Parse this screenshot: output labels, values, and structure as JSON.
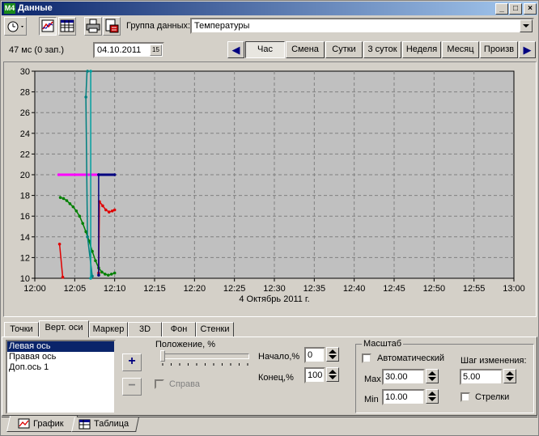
{
  "window": {
    "title": "Данные",
    "app_icon_text": "M4",
    "controls": [
      "_",
      "□",
      "×"
    ]
  },
  "toolbar": {
    "group_label": "Группа данных:",
    "group_value": "Температуры",
    "icons": [
      "clock-icon",
      "chart-view-icon",
      "table-view-icon",
      "print-icon",
      "export-icon"
    ]
  },
  "status": {
    "timing": "47 мс (0 зап.)",
    "date": "04.10.2011",
    "calendar_icon_text": "15"
  },
  "periods": {
    "prev_arrow": "◀",
    "next_arrow": "▶",
    "items": [
      "Час",
      "Смена",
      "Сутки",
      "3 суток",
      "Неделя",
      "Месяц",
      "Произв"
    ],
    "active_index": 0
  },
  "chart_data": {
    "type": "line",
    "ylim": [
      10,
      30
    ],
    "yticks": [
      "10",
      "12",
      "14",
      "16",
      "18",
      "20",
      "22",
      "24",
      "26",
      "28",
      "30"
    ],
    "xlim_minutes": [
      0,
      60
    ],
    "xticks": [
      "12:00",
      "12:05",
      "12:10",
      "12:15",
      "12:20",
      "12:25",
      "12:30",
      "12:35",
      "12:40",
      "12:45",
      "12:50",
      "12:55",
      "13:00"
    ],
    "xlabel": "4 Октябрь 2011 г.",
    "grid": true,
    "series": [
      {
        "color": "#008000",
        "points": [
          [
            3.2,
            17.8
          ],
          [
            3.6,
            17.7
          ],
          [
            4.0,
            17.5
          ],
          [
            4.4,
            17.2
          ],
          [
            4.8,
            16.9
          ],
          [
            5.2,
            16.5
          ],
          [
            5.6,
            16.0
          ],
          [
            6.0,
            15.3
          ],
          [
            6.4,
            14.5
          ],
          [
            6.8,
            13.6
          ],
          [
            7.2,
            12.6
          ],
          [
            7.6,
            11.7
          ],
          [
            8.0,
            11.0
          ],
          [
            8.4,
            10.6
          ],
          [
            8.8,
            10.4
          ],
          [
            9.2,
            10.3
          ],
          [
            9.6,
            10.4
          ],
          [
            10.0,
            10.5
          ]
        ]
      },
      {
        "color": "#e00000",
        "points": [
          [
            3.1,
            13.3
          ],
          [
            3.5,
            10.1
          ]
        ]
      },
      {
        "color": "#e00000",
        "points": [
          [
            8.0,
            10.5
          ],
          [
            8.1,
            17.4
          ],
          [
            8.5,
            17.0
          ],
          [
            8.9,
            16.6
          ],
          [
            9.3,
            16.4
          ],
          [
            9.7,
            16.5
          ],
          [
            10.0,
            16.6
          ]
        ]
      },
      {
        "color": "#ff00ff",
        "points": [
          [
            3.0,
            20.0
          ],
          [
            8.0,
            20.0
          ]
        ]
      },
      {
        "color": "#000080",
        "points": [
          [
            8.0,
            20.0
          ],
          [
            10.0,
            20.0
          ]
        ]
      },
      {
        "color": "#000080",
        "points": [
          [
            8.0,
            10.3
          ],
          [
            8.0,
            20.0
          ]
        ]
      },
      {
        "color": "#008080",
        "points": [
          [
            6.6,
            31.0
          ],
          [
            6.4,
            27.5
          ],
          [
            6.6,
            14.0
          ],
          [
            7.2,
            10.2
          ]
        ]
      },
      {
        "color": "#00a0a0",
        "points": [
          [
            7.0,
            31.0
          ],
          [
            7.0,
            10.0
          ]
        ]
      }
    ]
  },
  "tabs": {
    "items": [
      "Точки",
      "Верт. оси",
      "Маркер",
      "3D",
      "Фон",
      "Стенки"
    ],
    "active_index": 1
  },
  "axes_panel": {
    "axis_list": [
      "Левая ось",
      "Правая ось",
      "Доп.ось 1"
    ],
    "selected_index": 0,
    "add_label": "+",
    "remove_label": "−",
    "position_label": "Положение, %",
    "position_value": 0,
    "right_side_label": "Справа",
    "start_label": "Начало,%",
    "start_value": "0",
    "end_label": "Конец,%",
    "end_value": "100"
  },
  "scale": {
    "group_label": "Масштаб",
    "auto_label": "Автоматический",
    "auto_checked": false,
    "step_label": "Шаг изменения:",
    "step_value": "5.00",
    "max_label": "Max",
    "max_value": "30.00",
    "min_label": "Min",
    "min_value": "10.00",
    "arrows_label": "Стрелки",
    "arrows_checked": false
  },
  "bottom_tabs": {
    "items": [
      "График",
      "Таблица"
    ],
    "active_index": 0
  }
}
